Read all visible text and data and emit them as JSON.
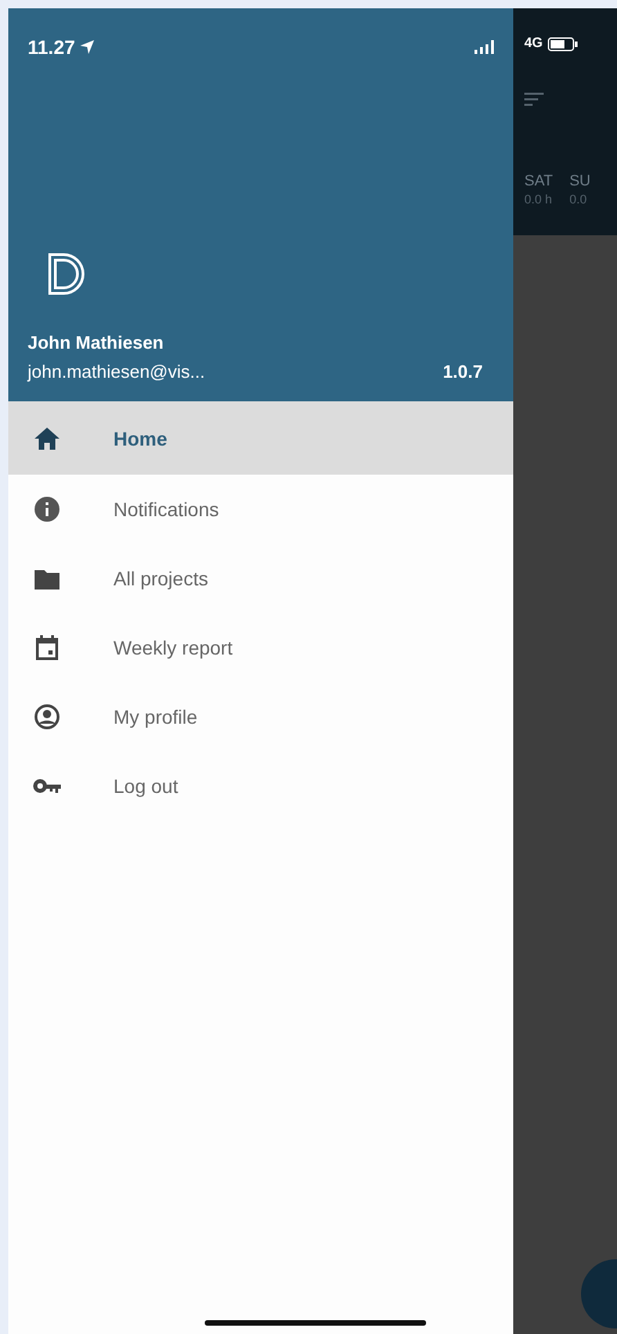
{
  "status_bar": {
    "time": "11.27",
    "network": "4G"
  },
  "user": {
    "name": "John Mathiesen",
    "email": "john.mathiesen@vis...",
    "version": "1.0.7"
  },
  "menu": [
    {
      "label": "Home",
      "kind": "home",
      "selected": true
    },
    {
      "label": "Notifications",
      "kind": "info",
      "selected": false
    },
    {
      "label": "All projects",
      "kind": "folder",
      "selected": false
    },
    {
      "label": "Weekly report",
      "kind": "calendar",
      "selected": false
    },
    {
      "label": "My profile",
      "kind": "profile",
      "selected": false
    },
    {
      "label": "Log out",
      "kind": "key",
      "selected": false
    }
  ],
  "background": {
    "days": [
      {
        "day": "SAT",
        "hours": "0.0 h"
      },
      {
        "day": "SU",
        "hours": "0.0"
      }
    ]
  }
}
